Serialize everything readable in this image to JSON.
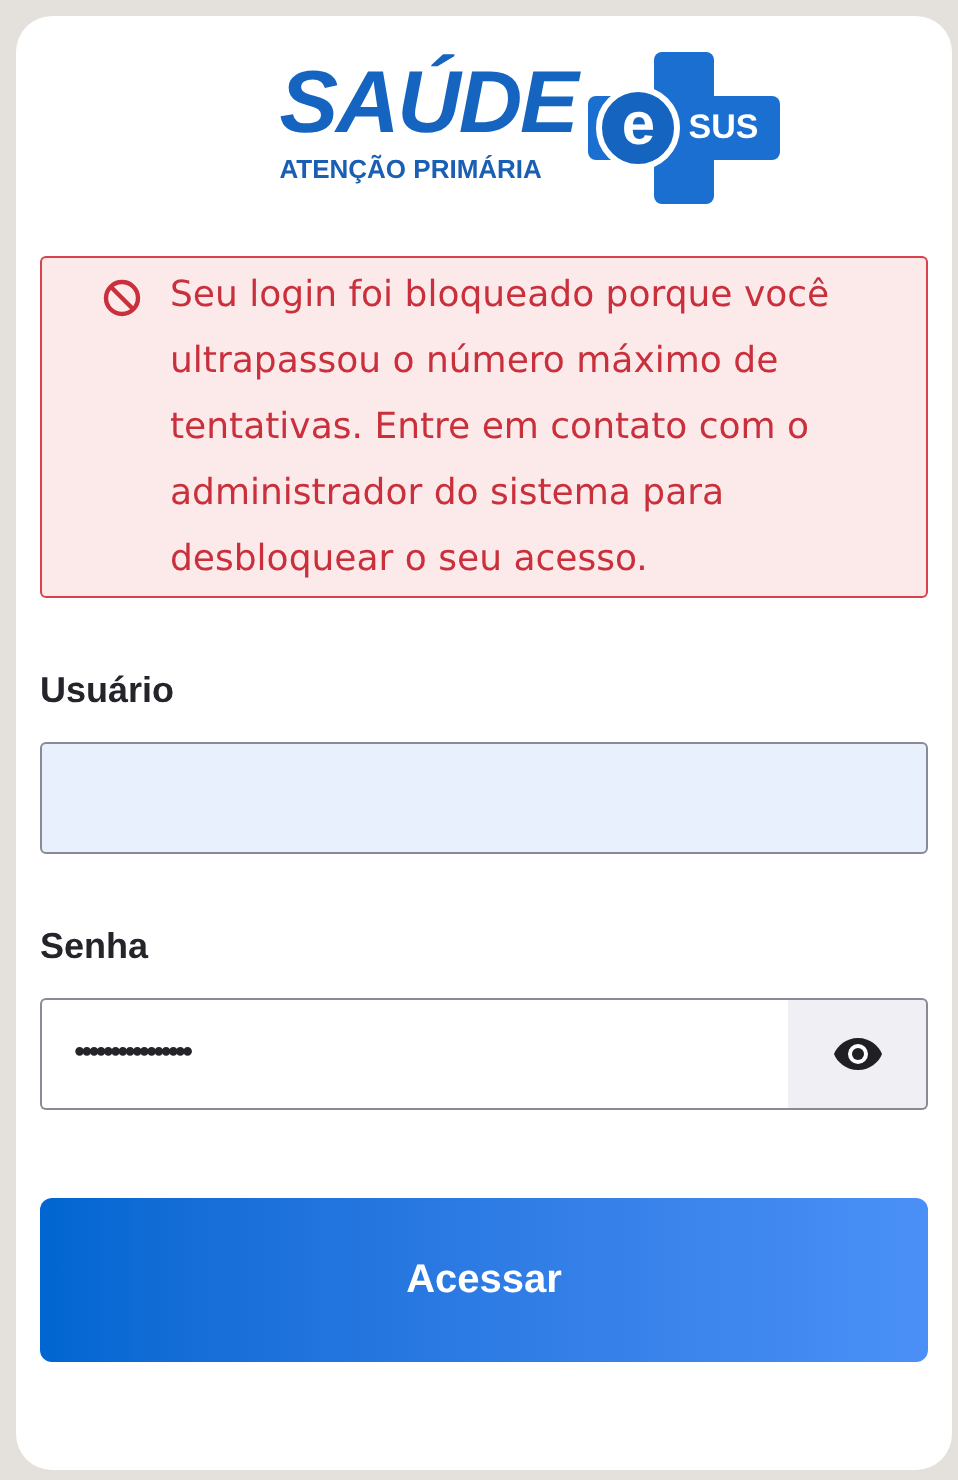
{
  "logo": {
    "title": "SAÚDE",
    "subtitle": "ATENÇÃO PRIMÁRIA",
    "badge_letter": "e",
    "badge_text": "SUS"
  },
  "alert": {
    "message": "Seu login foi bloqueado porque você ultrapassou o número máximo de tentativas. Entre em contato com o administrador do sistema para desbloquear o seu acesso."
  },
  "fields": [
    {
      "kind": "text",
      "label": "Usuário",
      "autofilled": true
    },
    {
      "kind": "password",
      "label": "Senha",
      "value": "••••••••••••••••",
      "autofilled": false
    }
  ],
  "submit": {
    "label": "Acessar"
  }
}
